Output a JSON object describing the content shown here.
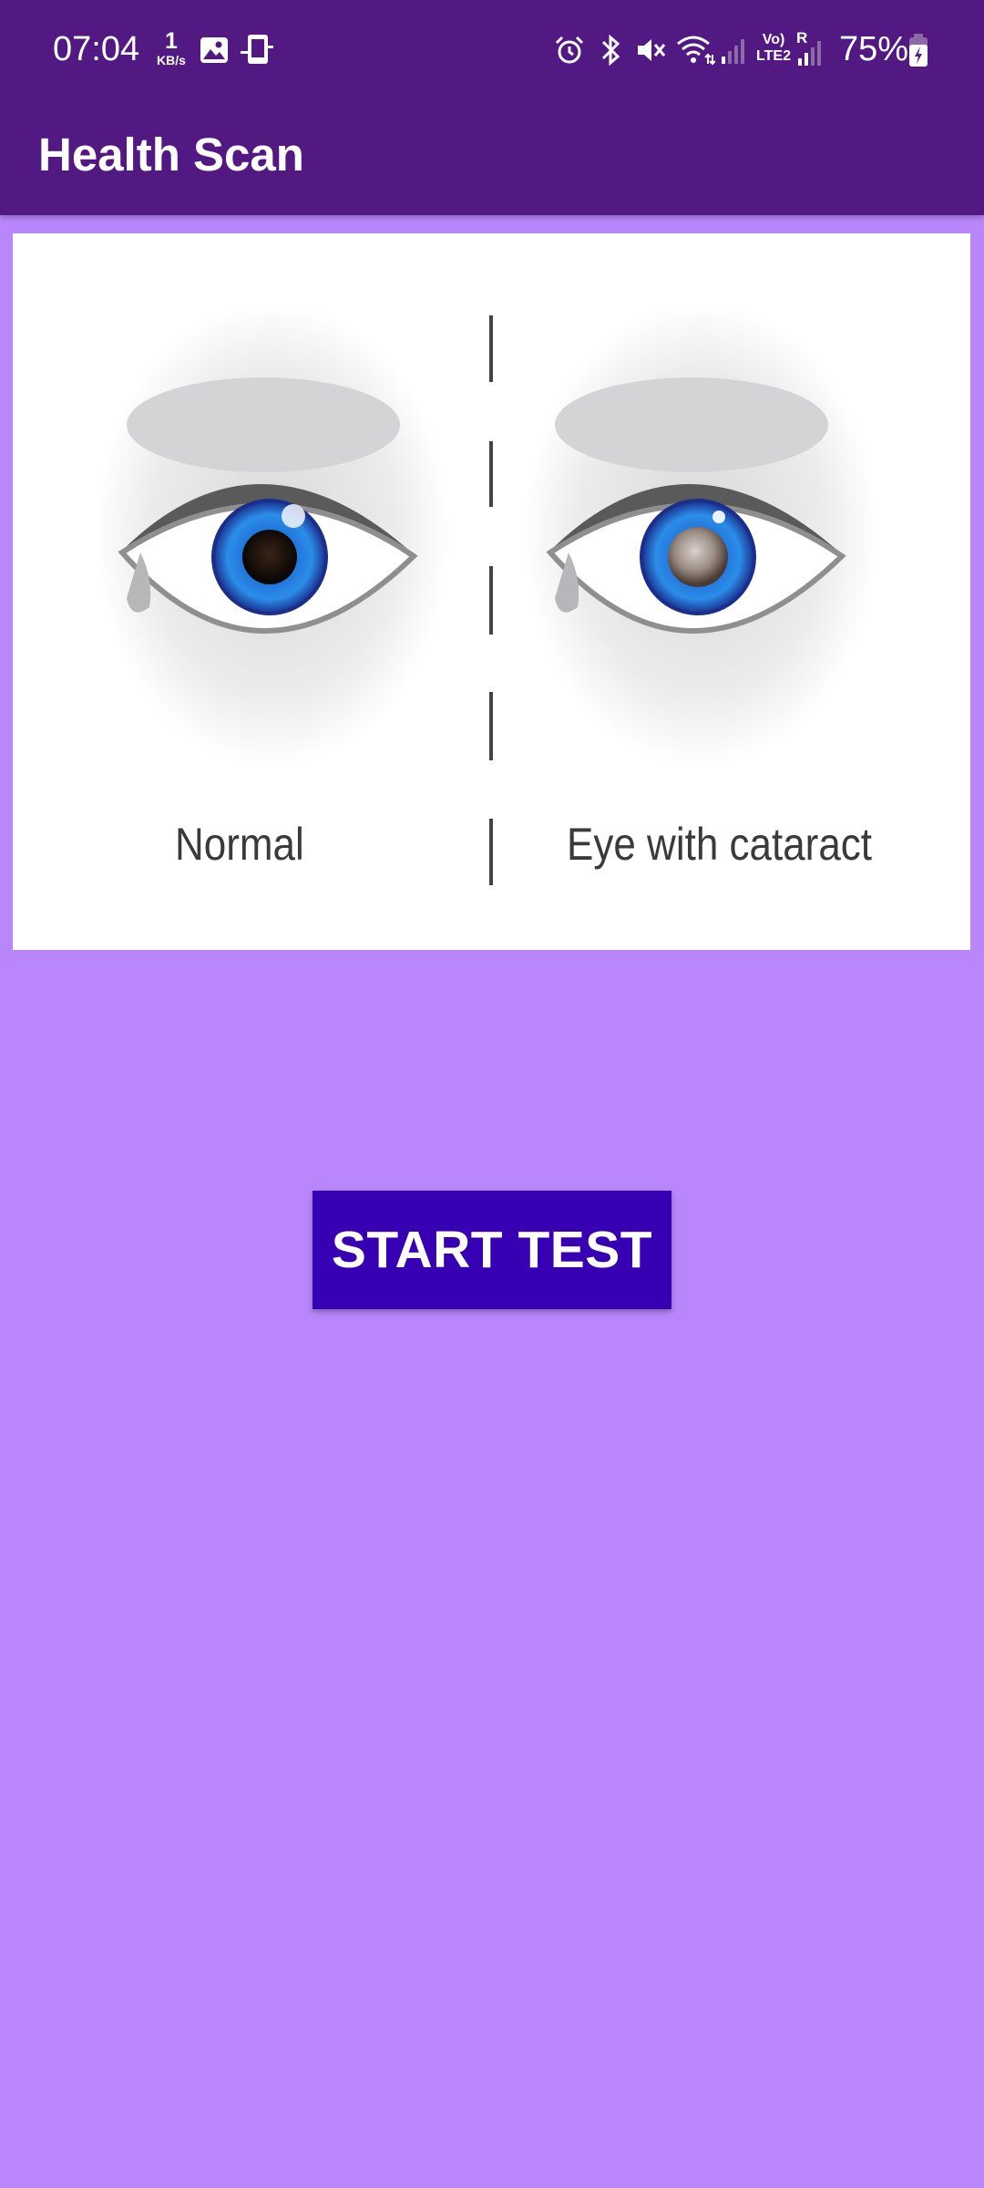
{
  "status_bar": {
    "time": "07:04",
    "network_speed_value": "1",
    "network_speed_unit": "KB/s",
    "network_type": "Vo) LTE2",
    "roaming": "R",
    "battery_percent": "75%",
    "icons": [
      "gallery-icon",
      "phone-sync-icon",
      "alarm-icon",
      "bluetooth-icon",
      "mute-icon",
      "wifi-icon",
      "signal-icon",
      "signal-icon",
      "battery-charging-icon"
    ]
  },
  "app_bar": {
    "title": "Health Scan"
  },
  "illustration": {
    "left_caption": "Normal",
    "right_caption": "Eye with cataract"
  },
  "main": {
    "start_button_label": "START TEST"
  },
  "colors": {
    "primary": "#531983",
    "background": "#b987fb",
    "button": "#3700b3"
  }
}
